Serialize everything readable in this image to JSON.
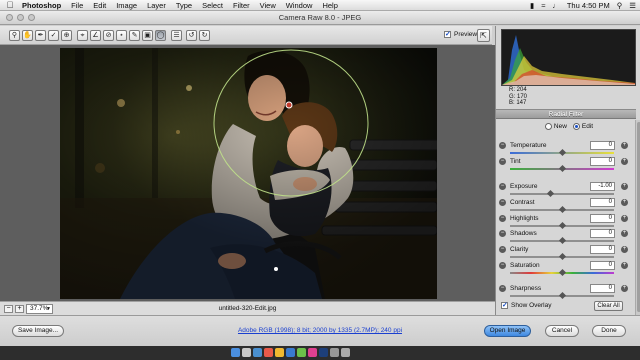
{
  "menubar": {
    "app": "Photoshop",
    "items": [
      "File",
      "Edit",
      "Image",
      "Layer",
      "Type",
      "Select",
      "Filter",
      "View",
      "Window",
      "Help"
    ],
    "clock": "Thu 4:50 PM"
  },
  "window": {
    "title": "Camera Raw 8.0  -  JPEG"
  },
  "toolbar": {
    "preview_label": "Preview",
    "preview_checked": true
  },
  "status": {
    "zoom": "37.7%",
    "filename": "untitled-320-Edit.jpg"
  },
  "histogram": {
    "r": "R:  204",
    "g": "G:  170",
    "b": "B:  147"
  },
  "panel": {
    "title": "Radial Filter",
    "mode_new": "New",
    "mode_edit": "Edit",
    "selected_mode": "Edit",
    "sliders": [
      {
        "label": "Temperature",
        "value": "0",
        "pos": 0.5
      },
      {
        "label": "Tint",
        "value": "0",
        "pos": 0.5
      },
      {
        "label": "Exposure",
        "value": "-1.00",
        "pos": 0.38
      },
      {
        "label": "Contrast",
        "value": "0",
        "pos": 0.5
      },
      {
        "label": "Highlights",
        "value": "0",
        "pos": 0.5
      },
      {
        "label": "Shadows",
        "value": "0",
        "pos": 0.5
      },
      {
        "label": "Clarity",
        "value": "0",
        "pos": 0.5
      },
      {
        "label": "Saturation",
        "value": "0",
        "pos": 0.5
      },
      {
        "label": "Sharpness",
        "value": "0",
        "pos": 0.5
      }
    ],
    "show_overlay": "Show Overlay",
    "clear_all": "Clear All"
  },
  "bottom": {
    "save_image": "Save Image...",
    "workflow": "Adobe RGB (1998); 8 bit; 2000 by 1335 (2.7MP); 240 ppi",
    "open_image": "Open Image",
    "cancel": "Cancel",
    "done": "Done"
  }
}
